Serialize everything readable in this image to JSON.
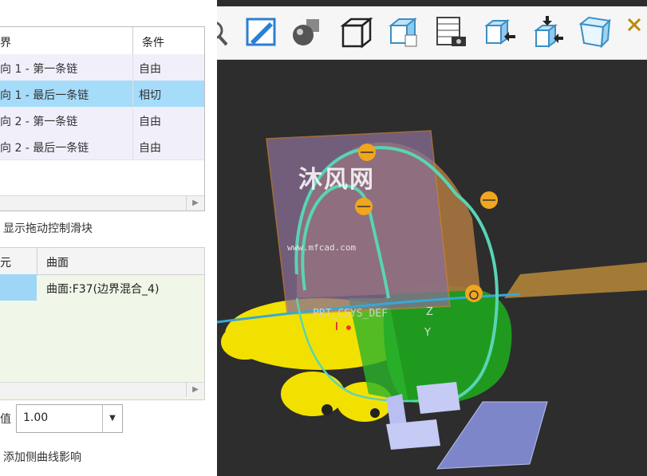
{
  "boundaries_table": {
    "col_boundary": "界",
    "col_condition": "条件",
    "rows": [
      {
        "boundary": "向 1 - 第一条链",
        "condition": "自由",
        "bg": "#f1effa"
      },
      {
        "boundary": "向 1 - 最后一条链",
        "condition": "相切",
        "bg": "#a5dcfa"
      },
      {
        "boundary": "向 2 - 第一条链",
        "condition": "自由",
        "bg": "#f1effa"
      },
      {
        "boundary": "向 2 - 最后一条链",
        "condition": "自由",
        "bg": "#f1effa"
      }
    ]
  },
  "show_drag_label": "显示拖动控制滑块",
  "surface_table": {
    "col_element": "元",
    "col_surface": "曲面",
    "cell_surface": "曲面:F37(边界混合_4)"
  },
  "value_label": "值",
  "value_field": "1.00",
  "add_side_curve_label": "添加侧曲线影响",
  "viewport": {
    "watermark": "沐风网",
    "watermark_url": "www.mfcad.com",
    "csys_label": "PRT_CSYS_DEF",
    "axis_z": "Z",
    "axis_y": "Y"
  },
  "toolbar": {
    "icons": [
      "search-icon",
      "sketch-view-icon",
      "shading-icon",
      "wireframe-box-icon",
      "saved-views-icon",
      "table-camera-icon",
      "insert-cube-icon",
      "datum-arrow-icon",
      "perspective-box-icon",
      "close-icon"
    ]
  },
  "colors": {
    "selection": "#a5dcfa",
    "viewport_bg": "#2d2d2d",
    "surface_orange": "#b07850",
    "teal_curve": "#59d4b4",
    "handle": "#f0a61d"
  }
}
